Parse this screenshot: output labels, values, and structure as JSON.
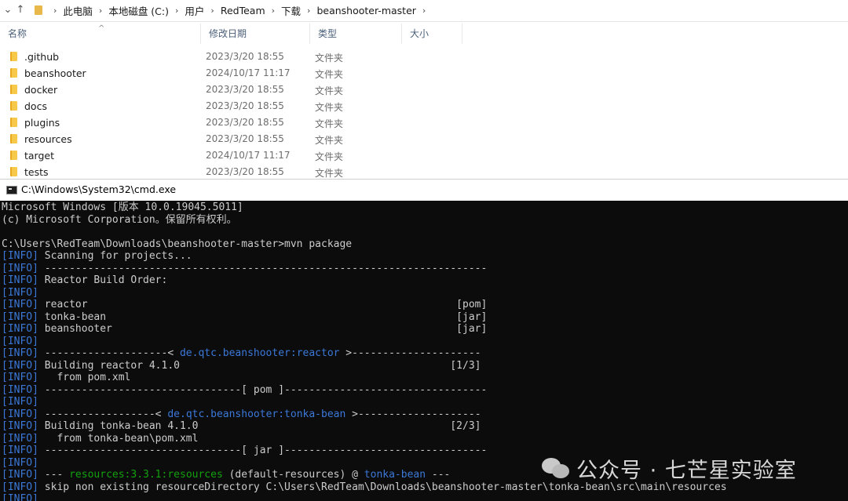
{
  "explorer": {
    "breadcrumbs": [
      "此电脑",
      "本地磁盘 (C:)",
      "用户",
      "RedTeam",
      "下载",
      "beanshooter-master"
    ],
    "columns": {
      "name": "名称",
      "date": "修改日期",
      "type": "类型",
      "size": "大小"
    },
    "rows": [
      {
        "name": ".github",
        "date": "2023/3/20 18:55",
        "type": "文件夹"
      },
      {
        "name": "beanshooter",
        "date": "2024/10/17 11:17",
        "type": "文件夹"
      },
      {
        "name": "docker",
        "date": "2023/3/20 18:55",
        "type": "文件夹"
      },
      {
        "name": "docs",
        "date": "2023/3/20 18:55",
        "type": "文件夹"
      },
      {
        "name": "plugins",
        "date": "2023/3/20 18:55",
        "type": "文件夹"
      },
      {
        "name": "resources",
        "date": "2023/3/20 18:55",
        "type": "文件夹"
      },
      {
        "name": "target",
        "date": "2024/10/17 11:17",
        "type": "文件夹"
      },
      {
        "name": "tests",
        "date": "2023/3/20 18:55",
        "type": "文件夹"
      }
    ]
  },
  "cmd": {
    "title": "C:\\Windows\\System32\\cmd.exe",
    "lines": [
      [
        {
          "t": "Microsoft Windows [版本 10.0.19045.5011]"
        }
      ],
      [
        {
          "t": "(c) Microsoft Corporation。保留所有权利。"
        }
      ],
      [
        {
          "t": ""
        }
      ],
      [
        {
          "t": "C:\\Users\\RedTeam\\Downloads\\beanshooter-master>mvn package"
        }
      ],
      [
        {
          "t": "[INFO]",
          "c": "tag"
        },
        {
          "t": " Scanning for projects..."
        }
      ],
      [
        {
          "t": "[INFO]",
          "c": "tag"
        },
        {
          "t": " ------------------------------------------------------------------------"
        }
      ],
      [
        {
          "t": "[INFO]",
          "c": "tag"
        },
        {
          "t": " Reactor Build Order:"
        }
      ],
      [
        {
          "t": "[INFO]",
          "c": "tag"
        }
      ],
      [
        {
          "t": "[INFO]",
          "c": "tag"
        },
        {
          "t": " reactor                                                            [pom]"
        }
      ],
      [
        {
          "t": "[INFO]",
          "c": "tag"
        },
        {
          "t": " tonka-bean                                                         [jar]"
        }
      ],
      [
        {
          "t": "[INFO]",
          "c": "tag"
        },
        {
          "t": " beanshooter                                                        [jar]"
        }
      ],
      [
        {
          "t": "[INFO]",
          "c": "tag"
        }
      ],
      [
        {
          "t": "[INFO]",
          "c": "tag"
        },
        {
          "t": " --------------------< "
        },
        {
          "t": "de.qtc.beanshooter:reactor",
          "c": "blue"
        },
        {
          "t": " >---------------------"
        }
      ],
      [
        {
          "t": "[INFO]",
          "c": "tag"
        },
        {
          "t": " Building reactor 4.1.0                                            [1/3]"
        }
      ],
      [
        {
          "t": "[INFO]",
          "c": "tag"
        },
        {
          "t": "   from pom.xml"
        }
      ],
      [
        {
          "t": "[INFO]",
          "c": "tag"
        },
        {
          "t": " --------------------------------[ pom ]---------------------------------"
        }
      ],
      [
        {
          "t": "[INFO]",
          "c": "tag"
        }
      ],
      [
        {
          "t": "[INFO]",
          "c": "tag"
        },
        {
          "t": " ------------------< "
        },
        {
          "t": "de.qtc.beanshooter:tonka-bean",
          "c": "blue"
        },
        {
          "t": " >--------------------"
        }
      ],
      [
        {
          "t": "[INFO]",
          "c": "tag"
        },
        {
          "t": " Building tonka-bean 4.1.0                                         [2/3]"
        }
      ],
      [
        {
          "t": "[INFO]",
          "c": "tag"
        },
        {
          "t": "   from tonka-bean\\pom.xml"
        }
      ],
      [
        {
          "t": "[INFO]",
          "c": "tag"
        },
        {
          "t": " --------------------------------[ jar ]---------------------------------"
        }
      ],
      [
        {
          "t": "[INFO]",
          "c": "tag"
        }
      ],
      [
        {
          "t": "[INFO]",
          "c": "tag"
        },
        {
          "t": " --- "
        },
        {
          "t": "resources:3.3.1:resources",
          "c": "green"
        },
        {
          "t": " (default-resources) @ "
        },
        {
          "t": "tonka-bean",
          "c": "blue"
        },
        {
          "t": " ---"
        }
      ],
      [
        {
          "t": "[INFO]",
          "c": "tag"
        },
        {
          "t": " skip non existing resourceDirectory C:\\Users\\RedTeam\\Downloads\\beanshooter-master\\tonka-bean\\src\\main\\resources"
        }
      ],
      [
        {
          "t": "[INFO]",
          "c": "tag"
        }
      ]
    ]
  },
  "watermark": {
    "text": "公众号 · 七芒星实验室"
  }
}
